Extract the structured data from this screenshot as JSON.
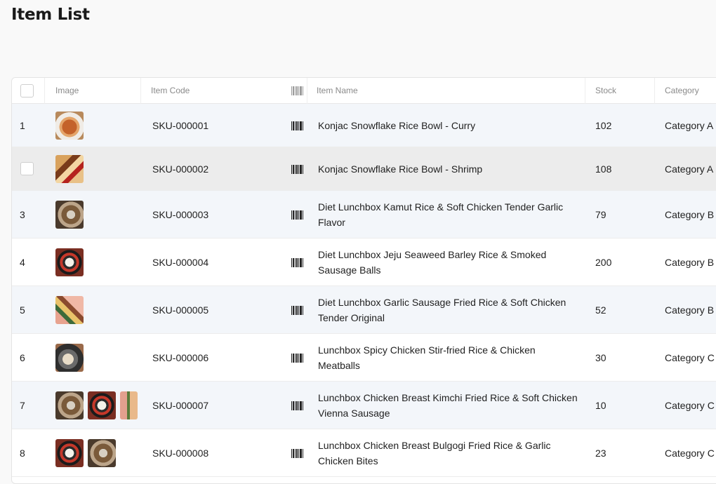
{
  "page": {
    "title": "Item List"
  },
  "table": {
    "columns": {
      "image": "Image",
      "item_code": "Item Code",
      "item_name": "Item Name",
      "stock": "Stock",
      "category": "Category"
    },
    "rows": [
      {
        "no": "1",
        "code": "SKU-000001",
        "name": "Konjac Snowflake Rice Bowl - Curry",
        "stock": "102",
        "category": "Category A",
        "images": [
          "curry"
        ]
      },
      {
        "no": "",
        "code": "SKU-000002",
        "name": "Konjac Snowflake Rice Bowl - Shrimp",
        "stock": "108",
        "category": "Category A",
        "images": [
          "shrimp"
        ]
      },
      {
        "no": "3",
        "code": "SKU-000003",
        "name": "Diet Lunchbox Kamut Rice & Soft Chicken Tender Garlic Flavor",
        "stock": "79",
        "category": "Category B",
        "images": [
          "kamut"
        ]
      },
      {
        "no": "4",
        "code": "SKU-000004",
        "name": "Diet Lunchbox Jeju Seaweed Barley Rice & Smoked Sausage Balls",
        "stock": "200",
        "category": "Category B",
        "images": [
          "jeju"
        ]
      },
      {
        "no": "5",
        "code": "SKU-000005",
        "name": "Diet Lunchbox Garlic Sausage Fried Rice & Soft Chicken Tender Original",
        "stock": "52",
        "category": "Category B",
        "images": [
          "garlic"
        ]
      },
      {
        "no": "6",
        "code": "SKU-000006",
        "name": "Lunchbox Spicy Chicken Stir-fried Rice & Chicken Meatballs",
        "stock": "30",
        "category": "Category C",
        "images": [
          "spicy"
        ]
      },
      {
        "no": "7",
        "code": "SKU-000007",
        "name": "Lunchbox Chicken Breast Kimchi Fried Rice & Soft Chicken Vienna Sausage",
        "stock": "10",
        "category": "Category C",
        "images": [
          "kamut",
          "jeju",
          "cut"
        ]
      },
      {
        "no": "8",
        "code": "SKU-000008",
        "name": "Lunchbox Chicken Breast Bulgogi Fried Rice & Garlic Chicken Bites",
        "stock": "23",
        "category": "Category C",
        "images": [
          "jeju",
          "kamut"
        ]
      }
    ]
  }
}
